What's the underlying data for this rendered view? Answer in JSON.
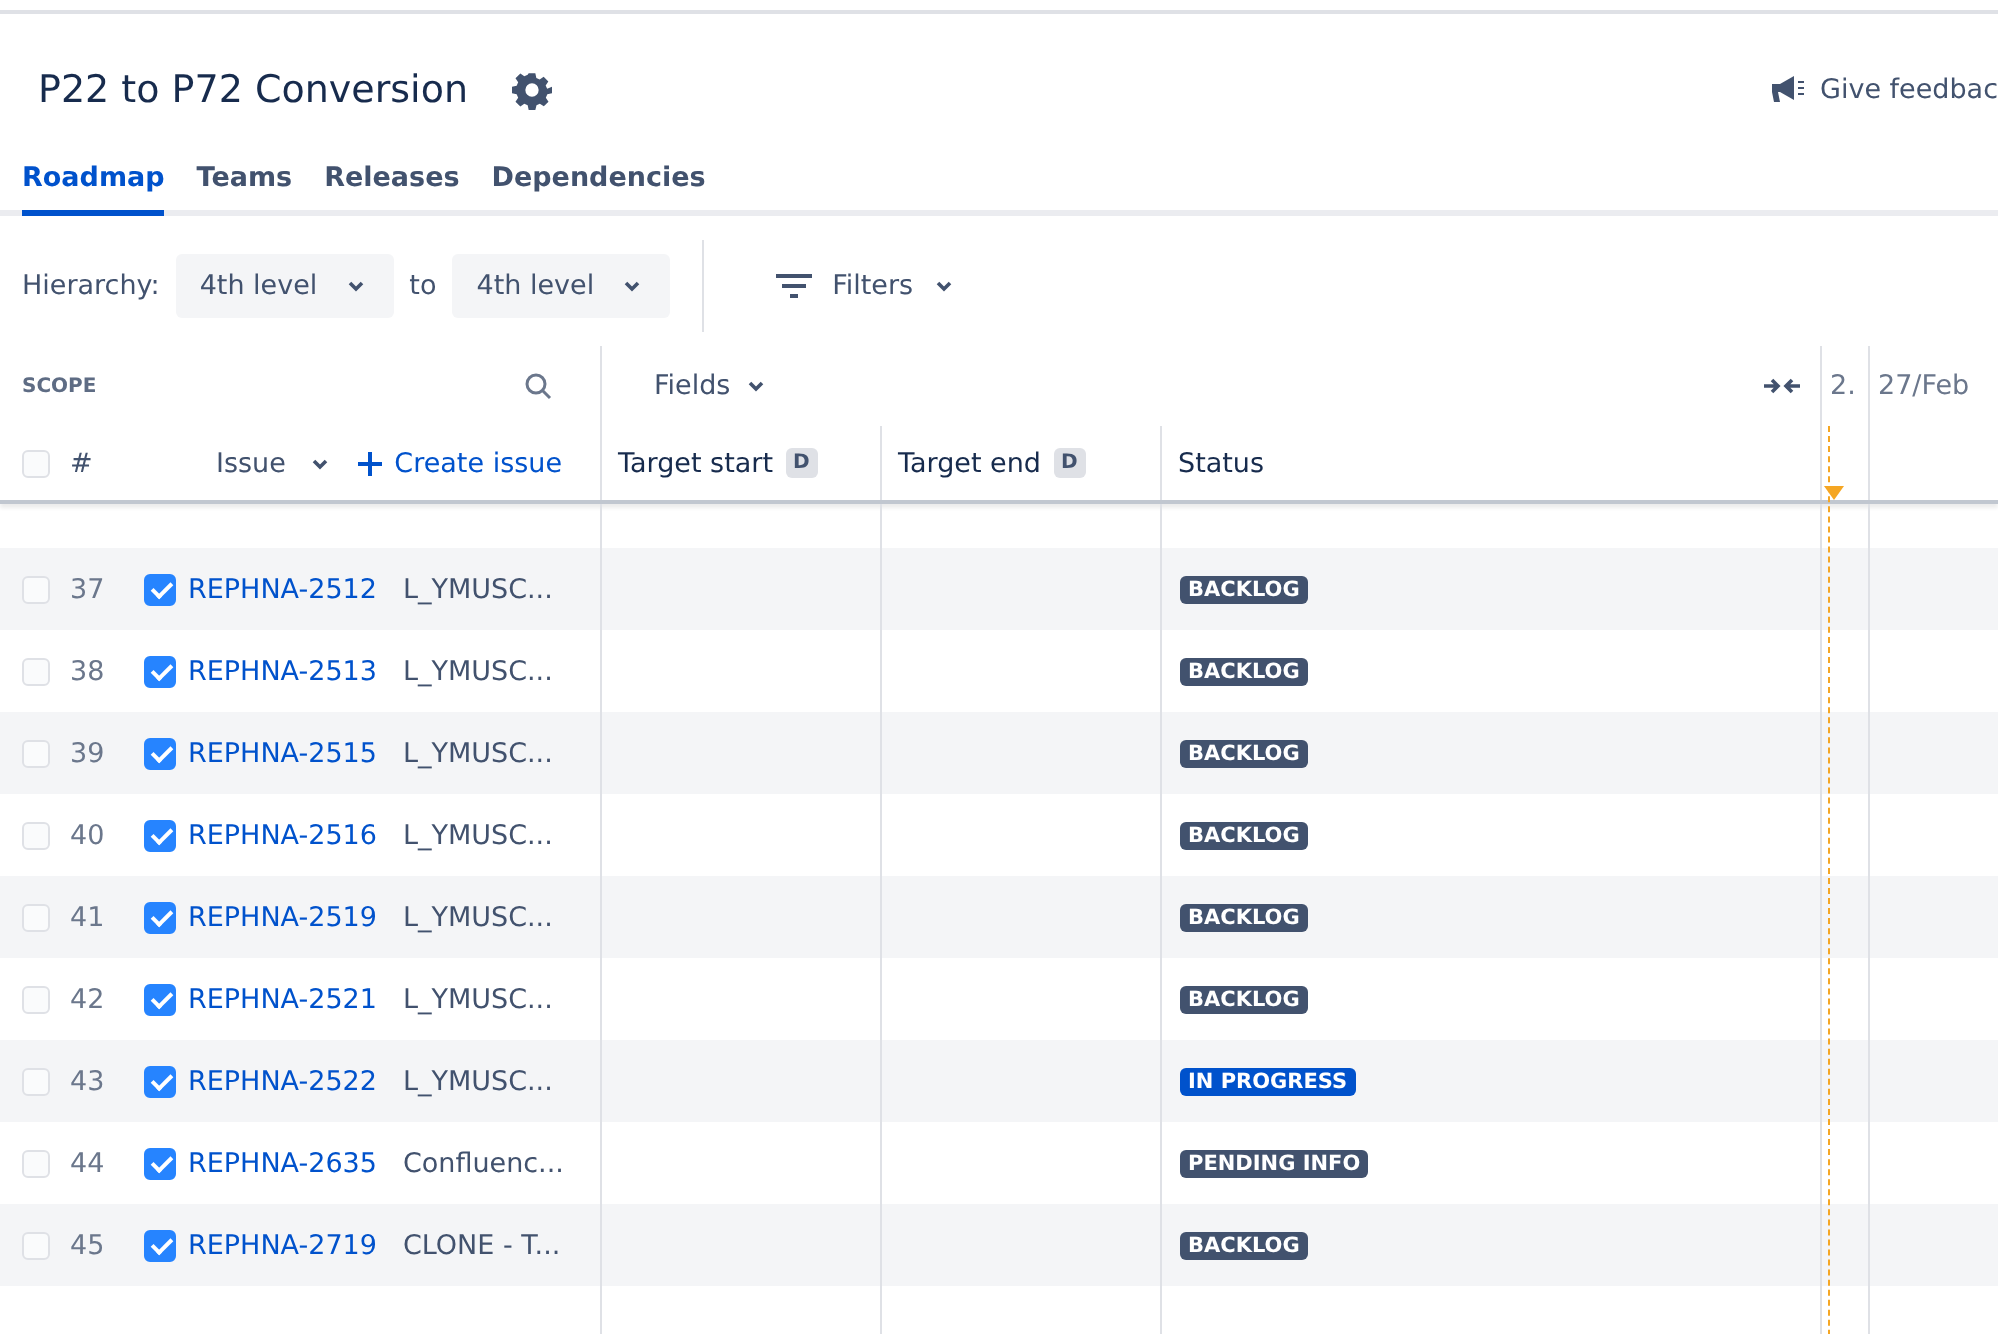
{
  "plan": {
    "title": "P22 to P72 Conversion",
    "feedback": "Give feedbac"
  },
  "tabs": [
    {
      "label": "Roadmap",
      "selected": true
    },
    {
      "label": "Teams",
      "selected": false
    },
    {
      "label": "Releases",
      "selected": false
    },
    {
      "label": "Dependencies",
      "selected": false
    }
  ],
  "toolbar": {
    "hierarchy_label": "Hierarchy:",
    "from": "4th level",
    "to_label": "to",
    "to": "4th level",
    "filters": "Filters"
  },
  "scope": {
    "title": "SCOPE",
    "number_header": "#",
    "issue_header": "Issue",
    "create_issue": "Create issue",
    "all_selected": false
  },
  "fields": {
    "label": "Fields",
    "columns": [
      {
        "label": "Target start",
        "badge": "D"
      },
      {
        "label": "Target end",
        "badge": "D"
      },
      {
        "label": "Status"
      }
    ]
  },
  "timeline": {
    "columns": [
      "2.",
      "27/Feb"
    ]
  },
  "rows": [
    {
      "number": "37",
      "selected": false,
      "included": true,
      "key": "REPHNA-2512",
      "summary": "L_YMUSC...",
      "status": "BACKLOG",
      "kind": "todo"
    },
    {
      "number": "38",
      "selected": false,
      "included": true,
      "key": "REPHNA-2513",
      "summary": "L_YMUSC...",
      "status": "BACKLOG",
      "kind": "todo"
    },
    {
      "number": "39",
      "selected": false,
      "included": true,
      "key": "REPHNA-2515",
      "summary": "L_YMUSC...",
      "status": "BACKLOG",
      "kind": "todo"
    },
    {
      "number": "40",
      "selected": false,
      "included": true,
      "key": "REPHNA-2516",
      "summary": "L_YMUSC...",
      "status": "BACKLOG",
      "kind": "todo"
    },
    {
      "number": "41",
      "selected": false,
      "included": true,
      "key": "REPHNA-2519",
      "summary": "L_YMUSC...",
      "status": "BACKLOG",
      "kind": "todo"
    },
    {
      "number": "42",
      "selected": false,
      "included": true,
      "key": "REPHNA-2521",
      "summary": "L_YMUSC...",
      "status": "BACKLOG",
      "kind": "todo"
    },
    {
      "number": "43",
      "selected": false,
      "included": true,
      "key": "REPHNA-2522",
      "summary": "L_YMUSC...",
      "status": "IN PROGRESS",
      "kind": "progress"
    },
    {
      "number": "44",
      "selected": false,
      "included": true,
      "key": "REPHNA-2635",
      "summary": "Confluenc...",
      "status": "PENDING INFO",
      "kind": "todo"
    },
    {
      "number": "45",
      "selected": false,
      "included": true,
      "key": "REPHNA-2719",
      "summary": "CLONE - T...",
      "status": "BACKLOG",
      "kind": "todo"
    }
  ]
}
